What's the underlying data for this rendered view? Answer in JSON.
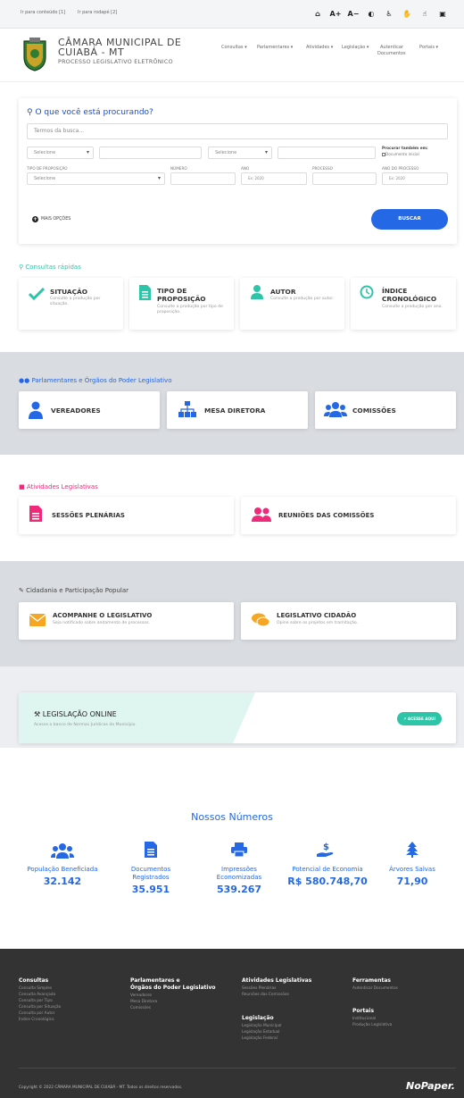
{
  "skip": [
    "Ir para conteúdo [1]",
    "Ir para rodapé [2]"
  ],
  "accessibility": [
    {
      "icon": "home-icon",
      "glyph": "⌂"
    },
    {
      "icon": "font-increase-icon",
      "glyph": "A+"
    },
    {
      "icon": "font-decrease-icon",
      "glyph": "A−"
    },
    {
      "icon": "contrast-icon",
      "glyph": "◐"
    },
    {
      "icon": "accessibility-icon",
      "glyph": "♿"
    },
    {
      "icon": "sign-language-icon",
      "glyph": "✋"
    },
    {
      "icon": "libras-icon",
      "glyph": "☝"
    },
    {
      "icon": "lock-icon",
      "glyph": "🔒"
    }
  ],
  "header": {
    "title_line1": "CÂMARA MUNICIPAL DE",
    "title_line2": "CUIABÁ - MT",
    "subtitle": "PROCESSO LEGISLATIVO ELETRÔNICO"
  },
  "nav": [
    "Consultas ▾",
    "Parlamentares ▾",
    "Atividades ▾",
    "Legislação ▾",
    "Autenticar",
    "Documentos",
    "Portais ▾"
  ],
  "search": {
    "title": "O que você está procurando?",
    "placeholder": "Termos da busca...",
    "select1": "Selecione",
    "select2": "Selecione",
    "also_search_label": "Procurar também em:",
    "doc_inicial_label": "Documento inicial",
    "tipo_label": "TIPO DE PROPOSIÇÃO",
    "tipo_value": "Selecione",
    "numero_label": "NÚMERO",
    "ano_label": "ANO",
    "ano_placeholder": "Ex: 2020",
    "processo_label": "PROCESSO",
    "ano_processo_label": "ANO DO PROCESSO",
    "ano_processo_placeholder": "Ex: 2020",
    "mais_opcoes": "MAIS OPÇÕES",
    "buscar": "BUSCAR"
  },
  "quick": {
    "title": "Consultas rápidas",
    "color": "#2ec4a8",
    "items": [
      {
        "title": "SITUAÇÃO",
        "sub": "Consulte a produção por situação."
      },
      {
        "title": "TIPO DE PROPOSIÇÃO",
        "sub": "Consulte a produção por tipo de proposição."
      },
      {
        "title": "AUTOR",
        "sub": "Consulte a produção por autor."
      },
      {
        "title": "ÍNDICE CRONOLÓGICO",
        "sub": "Consulte a produção por ano."
      }
    ]
  },
  "parl": {
    "title": "Parlamentares e Órgãos do Poder Legislativo",
    "color": "#2468e6",
    "items": [
      "VEREADORES",
      "MESA DIRETORA",
      "COMISSÕES"
    ]
  },
  "ativ": {
    "title": "Atividades Legislativas",
    "color": "#f0297a",
    "items": [
      "SESSÕES PLENÁRIAS",
      "REUNIÕES DAS COMISSÕES"
    ]
  },
  "cid": {
    "title": "Cidadania e Participação Popular",
    "color": "#f5a623",
    "items": [
      {
        "title": "ACOMPANHE O LEGISLATIVO",
        "sub": "Seja notificado sobre andamento de processos."
      },
      {
        "title": "LEGISLATIVO CIDADÃO",
        "sub": "Opine sobre os projetos em tramitação."
      }
    ]
  },
  "legis": {
    "title": "LEGISLAÇÃO ONLINE",
    "sub": "Acesse o banco de Normas Jurídicas do Município.",
    "button": "ACESSE AQUI"
  },
  "numbers": {
    "title": "Nossos Números",
    "items": [
      {
        "label": "População Beneficiada",
        "value": "32.142"
      },
      {
        "label": "Documentos Registrados",
        "value": "35.951"
      },
      {
        "label": "Impressões Economizadas",
        "value": "539.267"
      },
      {
        "label": "Potencial de Economia",
        "value": "R$ 580.748,70"
      },
      {
        "label": "Árvores Salvas",
        "value": "71,90"
      }
    ]
  },
  "footer": {
    "col1": {
      "title": "Consultas",
      "links": [
        "Consulta Simples",
        "Consulta Avançada",
        "Consulta por Tipo",
        "Consulta por Situação",
        "Consulta por Autor",
        "Índice Cronológico"
      ]
    },
    "col2": {
      "title1": "Parlamentares e",
      "title2": "Órgãos do Poder Legislativo",
      "links": [
        "Vereadores",
        "Mesa Diretora",
        "Comissões"
      ]
    },
    "col3": {
      "title": "Atividades Legislativas",
      "links": [
        "Sessões Plenárias",
        "Reuniões das Comissões"
      ],
      "title2": "Legislação",
      "links2": [
        "Legislação Municipal",
        "Legislação Estadual",
        "Legislação Federal"
      ]
    },
    "col4": {
      "title": "Ferramentas",
      "links": [
        "Autenticar Documentos"
      ],
      "title2": "Portais",
      "links2": [
        "Institucional",
        "Produção Legislativa"
      ]
    },
    "copyright": "Copyright © 2022 CÂMARA MUNICIPAL DE CUIABÁ - MT. Todos os direitos reservados.",
    "brand": "NoPaper."
  }
}
